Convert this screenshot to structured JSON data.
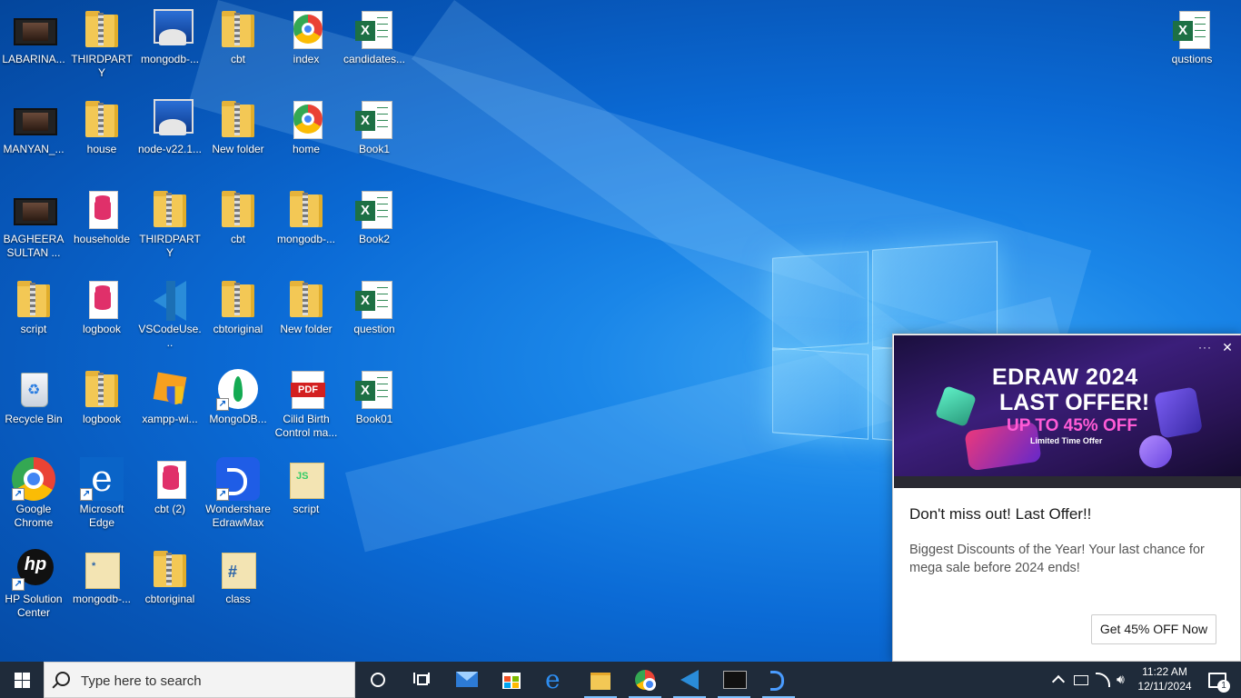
{
  "desktop": {
    "icons": [
      {
        "label": "LABARINA..."
      },
      {
        "label": "THIRDPARTY"
      },
      {
        "label": "mongodb-..."
      },
      {
        "label": "cbt"
      },
      {
        "label": "index"
      },
      {
        "label": "candidates..."
      },
      {
        "label": "MANYAN_..."
      },
      {
        "label": "house"
      },
      {
        "label": "node-v22.1..."
      },
      {
        "label": "New folder"
      },
      {
        "label": "home"
      },
      {
        "label": "Book1"
      },
      {
        "label": "BAGHEERA SULTAN ..."
      },
      {
        "label": "householde"
      },
      {
        "label": "THIRDPARTY"
      },
      {
        "label": "cbt"
      },
      {
        "label": "mongodb-..."
      },
      {
        "label": "Book2"
      },
      {
        "label": "script"
      },
      {
        "label": "logbook"
      },
      {
        "label": "VSCodeUse..."
      },
      {
        "label": "cbtoriginal"
      },
      {
        "label": "New folder"
      },
      {
        "label": "question"
      },
      {
        "label": "Recycle Bin"
      },
      {
        "label": "logbook"
      },
      {
        "label": "xampp-wi..."
      },
      {
        "label": "MongoDB..."
      },
      {
        "label": "Cilid Birth Control ma..."
      },
      {
        "label": "Book01"
      },
      {
        "label": "Google Chrome"
      },
      {
        "label": "Microsoft Edge"
      },
      {
        "label": "cbt (2)"
      },
      {
        "label": "Wondershare EdrawMax"
      },
      {
        "label": "script"
      },
      {
        "label": "HP Solution Center"
      },
      {
        "label": "mongodb-..."
      },
      {
        "label": "cbtoriginal"
      },
      {
        "label": "class"
      },
      {
        "label": "qustions"
      }
    ]
  },
  "notification": {
    "banner_line1": "EDRAW 2024",
    "banner_line2": "LAST OFFER!",
    "banner_line3": "UP TO 45% OFF",
    "banner_line4": "Limited Time Offer",
    "more_label": "···",
    "close_label": "✕",
    "title": "Don't miss out! Last Offer!!",
    "body": "Biggest Discounts of the Year! Your last chance for mega sale before 2024 ends!",
    "action_label": "Get 45% OFF Now"
  },
  "taskbar": {
    "search_placeholder": "Type here to search",
    "time": "11:22 AM",
    "date": "12/11/2024",
    "notification_count": "1",
    "pinned": [
      "cortana-icon",
      "task-view-icon",
      "mail-icon",
      "store-icon",
      "edge-icon",
      "file-explorer-icon",
      "chrome-icon",
      "vscode-icon",
      "terminal-icon",
      "edrawmax-icon"
    ]
  }
}
